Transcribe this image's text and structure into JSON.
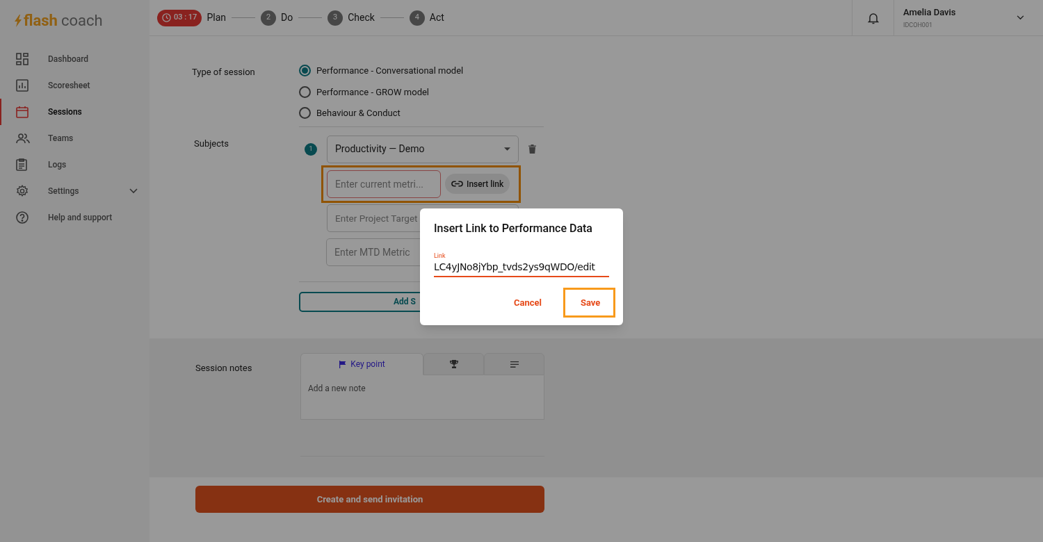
{
  "logo": {
    "flash": "flash",
    "coach": "coach"
  },
  "stepper": [
    {
      "kind": "timer",
      "timer": "03 : 17",
      "label": "Plan"
    },
    {
      "kind": "number",
      "number": "2",
      "label": "Do"
    },
    {
      "kind": "number",
      "number": "3",
      "label": "Check"
    },
    {
      "kind": "number",
      "number": "4",
      "label": "Act"
    }
  ],
  "user": {
    "name": "Amelia Davis",
    "id": "IDCOH001"
  },
  "sidebar": {
    "items": [
      {
        "label": "Dashboard",
        "selected": false,
        "submenu": false
      },
      {
        "label": "Scoresheet",
        "selected": false,
        "submenu": false
      },
      {
        "label": "Sessions",
        "selected": true,
        "submenu": false
      },
      {
        "label": "Teams",
        "selected": false,
        "submenu": false
      },
      {
        "label": "Logs",
        "selected": false,
        "submenu": false
      },
      {
        "label": "Settings",
        "selected": false,
        "submenu": true
      },
      {
        "label": "Help and support",
        "selected": false,
        "submenu": false
      }
    ]
  },
  "type_of_session": {
    "label": "Type of session",
    "options": [
      {
        "label": "Performance - Conversational model",
        "selected": true
      },
      {
        "label": "Performance - GROW model",
        "selected": false
      },
      {
        "label": "Behaviour & Conduct",
        "selected": false
      }
    ]
  },
  "subjects": {
    "label": "Subjects",
    "items": [
      {
        "number": "1",
        "value": "Productivity — Demo",
        "metric_placeholder": "Enter current metri...",
        "metric_highlighted": true,
        "link_button": "Insert link",
        "target_placeholder": "Enter Project Target",
        "mtd_placeholder": "Enter MTD Metric"
      }
    ],
    "add_button": "Add S"
  },
  "session_notes": {
    "label": "Session notes",
    "tabs": [
      {
        "kind": "flag",
        "label": "Key point",
        "selected": true
      },
      {
        "kind": "trophy",
        "selected": false
      },
      {
        "kind": "lines",
        "selected": false
      }
    ],
    "placeholder": "Add a new note"
  },
  "primary_button": "Create and send invitation",
  "dialog": {
    "title": "Insert Link to Performance Data",
    "field_label": "Link",
    "field_value": "LC4yJNo8jYbp_tvds2ys9qWDO/edit",
    "buttons": [
      {
        "label": "Cancel",
        "highlighted": false
      },
      {
        "label": "Save",
        "highlighted": true
      }
    ]
  }
}
